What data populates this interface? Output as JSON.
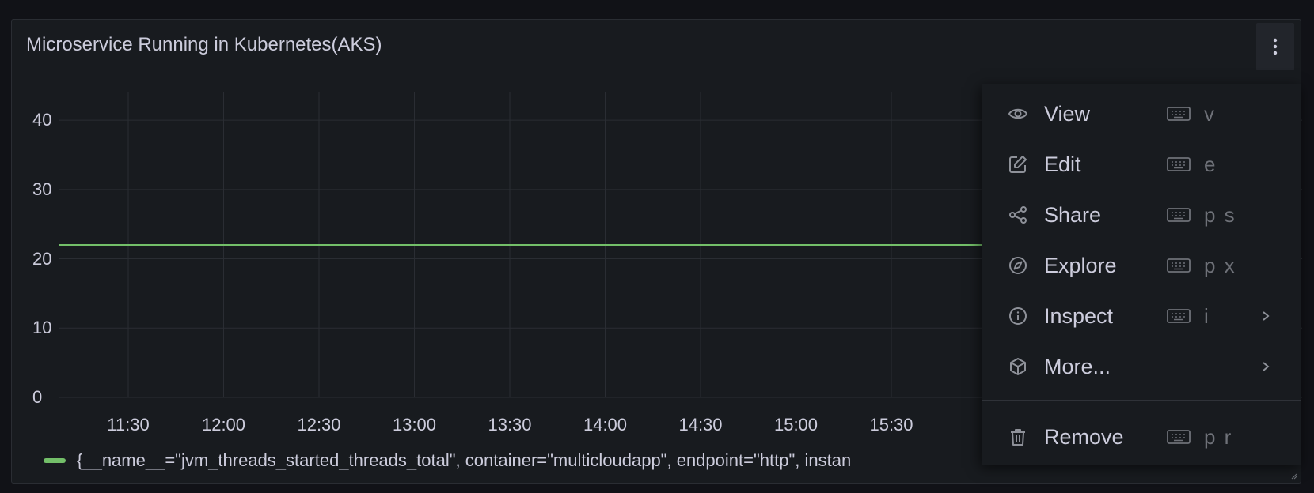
{
  "panel": {
    "title": "Microservice Running in Kubernetes(AKS)"
  },
  "chart_data": {
    "type": "line",
    "title": "Microservice Running in Kubernetes(AKS)",
    "y_ticks": [
      "40",
      "30",
      "20",
      "10",
      "0"
    ],
    "ylim": [
      0,
      44
    ],
    "x_ticks": [
      "11:30",
      "12:00",
      "12:30",
      "13:00",
      "13:30",
      "14:00",
      "14:30",
      "15:00",
      "15:30"
    ],
    "grid": true,
    "legend_placement": "bottom-left",
    "series": [
      {
        "name": "{__name__=\"jvm_threads_started_threads_total\", container=\"multicloudapp\", endpoint=\"http\", instan",
        "color": "#73bf69",
        "x": [
          "11:30",
          "12:00",
          "12:30",
          "13:00",
          "13:30",
          "14:00",
          "14:30",
          "15:00",
          "15:30"
        ],
        "values": [
          22,
          22,
          22,
          22,
          22,
          22,
          22,
          22,
          22
        ]
      }
    ]
  },
  "legend": {
    "label": "{__name__=\"jvm_threads_started_threads_total\", container=\"multicloudapp\", endpoint=\"http\", instan",
    "color": "#73bf69"
  },
  "menu": {
    "items": [
      {
        "label": "View",
        "icon": "eye-icon",
        "shortcut": "v",
        "submenu": false
      },
      {
        "label": "Edit",
        "icon": "edit-icon",
        "shortcut": "e",
        "submenu": false
      },
      {
        "label": "Share",
        "icon": "share-icon",
        "shortcut": "p s",
        "submenu": false
      },
      {
        "label": "Explore",
        "icon": "compass-icon",
        "shortcut": "p x",
        "submenu": false
      },
      {
        "label": "Inspect",
        "icon": "info-icon",
        "shortcut": "i",
        "submenu": true
      },
      {
        "label": "More...",
        "icon": "cube-icon",
        "shortcut": "",
        "submenu": true
      }
    ],
    "remove": {
      "label": "Remove",
      "icon": "trash-icon",
      "shortcut": "p r"
    }
  },
  "colors": {
    "background": "#111217",
    "panel": "#181b1f",
    "text": "#ccccdc",
    "muted": "#6e7178",
    "series": "#73bf69"
  }
}
